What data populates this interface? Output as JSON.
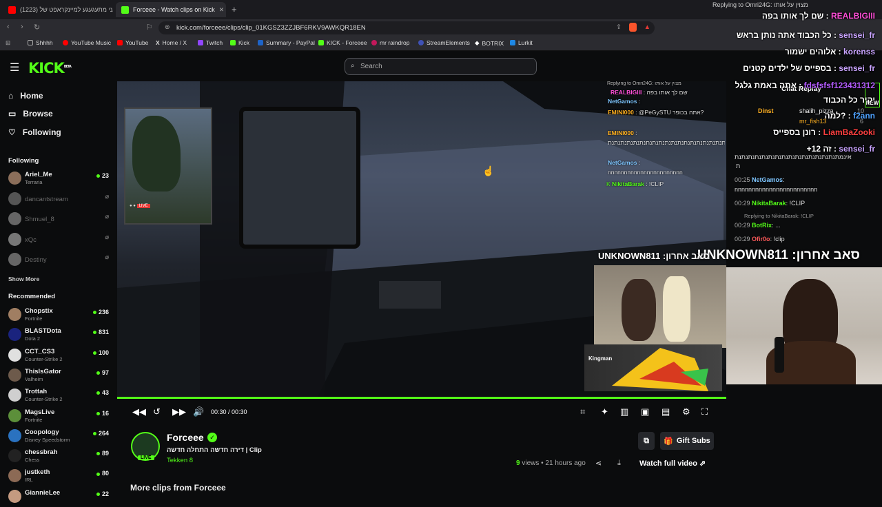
{
  "browser": {
    "tabs": [
      {
        "title": "(1223) אני מתעגעגע למיינקראפט של"
      },
      {
        "title": "Forceee - Watch clips on Kick"
      }
    ],
    "url": "kick.com/forceee/clips/clip_01KGSZ3ZZJBF6RKV9AWKQR18EN",
    "bookmarks": [
      "Shhhh",
      "YouTube Music",
      "YouTube",
      "Home / X",
      "Twitch",
      "Kick",
      "Summary - PayPal",
      "KICK - Forceee",
      "mr raindrop",
      "StreamElements",
      "BOTRIX",
      "Lurkit"
    ]
  },
  "kick": {
    "logo": "KICK",
    "logo_badge": "BETA",
    "search_placeholder": "Search"
  },
  "sidebar": {
    "nav": [
      {
        "label": "Home"
      },
      {
        "label": "Browse"
      },
      {
        "label": "Following"
      }
    ],
    "following_title": "Following",
    "following": [
      {
        "name": "Ariel_Me",
        "game": "Terraria",
        "viewers": "23",
        "live": true,
        "color": "#8b6e5a"
      },
      {
        "name": "dancantstream",
        "live": false,
        "color": "#555"
      },
      {
        "name": "Shmuel_8",
        "live": false,
        "color": "#666"
      },
      {
        "name": "xQc",
        "live": false,
        "color": "#777"
      },
      {
        "name": "Destiny",
        "live": false,
        "color": "#666"
      }
    ],
    "show_more": "Show More",
    "recommended_title": "Recommended",
    "recommended": [
      {
        "name": "Chopstix",
        "game": "Fortnite",
        "viewers": "236",
        "color": "#a07e62"
      },
      {
        "name": "BLASTDota",
        "game": "Dota 2",
        "viewers": "831",
        "color": "#1a237e"
      },
      {
        "name": "CCT_CS3",
        "game": "Counter-Strike 2",
        "viewers": "100",
        "color": "#e0e0e0"
      },
      {
        "name": "ThisIsGator",
        "game": "Valheim",
        "viewers": "97",
        "color": "#6d5a4b"
      },
      {
        "name": "Trottah",
        "game": "Counter-Strike 2",
        "viewers": "43",
        "color": "#cfcfcf"
      },
      {
        "name": "MagsLive",
        "game": "Fortnite",
        "viewers": "16",
        "color": "#5c8f3a"
      },
      {
        "name": "Coopology",
        "game": "Disney Speedstorm",
        "viewers": "264",
        "color": "#2a72c0"
      },
      {
        "name": "chessbrah",
        "game": "Chess",
        "viewers": "89",
        "color": "#222"
      },
      {
        "name": "justketh",
        "game": "IRL",
        "viewers": "80",
        "color": "#8c6a55"
      },
      {
        "name": "GiannieLee",
        "game": "",
        "viewers": "22",
        "color": "#c49a80"
      }
    ]
  },
  "player": {
    "time": "00:30 / 00:30",
    "progress": 1.0
  },
  "clip": {
    "channel": "Forceee",
    "title": "דירה חדשה התחלה חדשה | Clip",
    "game": "Tekken 8",
    "live_badge": "LIVE",
    "views_num": "9",
    "views_label": "views",
    "ago": "21 hours ago",
    "gift_subs": "Gift Subs",
    "watch_full": "Watch full video",
    "more_clips": "More clips from Forceee"
  },
  "chat_replay": {
    "title": "Chat Replay",
    "new_badge": "NEW",
    "replying_to_nikita": "Replying to NikitaBarak: !CLIP",
    "lines": [
      {
        "time": "",
        "user": "",
        "text": "אינמתנתנתנתנתנתנתנתנתנתנתנתנתנתנתנת"
      },
      {
        "time": "00:25",
        "user": "NetGamos",
        "text": "nnnnnnnnnnnnnnnnnnnnnnnn"
      },
      {
        "time": "00:29",
        "user": "NikitaBarak",
        "text": "!CLIP"
      },
      {
        "time": "00:29",
        "user": "BotRix",
        "text": "..."
      },
      {
        "time": "00:29",
        "user": "Ofir0o",
        "text": "!clip"
      }
    ],
    "side_users": [
      {
        "user": "Dinst",
        "extra": "shalih_pizza",
        "count": "10"
      },
      {
        "user": "mr_fish13",
        "count": "6"
      }
    ]
  },
  "overlay_chat": {
    "reply_header": "Replying to Omri24G: מצוין על אותו",
    "lines": [
      {
        "user": "REALBIGIII",
        "text": "שם לך אותו בפה",
        "color": "#ff4fd8"
      },
      {
        "user": "sensei_fr",
        "text": "כל הכבוד אתה נותן בראש",
        "color": "#c9a4ff"
      },
      {
        "user": "korenss",
        "text": "אלוהים ישמור",
        "color": "#c9a4ff"
      },
      {
        "user": "sensei_fr",
        "text": "בספייס של ילדים קטנים",
        "color": "#c9a4ff"
      },
      {
        "user": "fdsfsfsf123431312",
        "text": "אתה באמת גלגל",
        "color": "#b45cff"
      },
      {
        "user": "",
        "text": "יקיר כל הכבוד",
        "color": "#fff"
      },
      {
        "user": "f2ann",
        "text": "למה?",
        "color": "#4fa3ff"
      },
      {
        "user": "LiamBaZooki",
        "text": "רונן בספייס",
        "color": "#ff4040"
      },
      {
        "user": "sensei_fr",
        "text": "+12 זה",
        "color": "#c9a4ff"
      }
    ],
    "sub_banner": "UNKNOWN811 :סאב אחרון",
    "sub_banner_small": "UNKNOWN811 :סאב אחרון"
  },
  "video_chat": {
    "header": "Replying to Omri24G: מצוין על אותו",
    "lines": [
      {
        "user": "REALBIGIII",
        "text": "שם לך אותו בפה"
      },
      {
        "user": "NetGamos",
        "text": ""
      },
      {
        "user": "EMINI000",
        "text": "@PeGySTU אתה בכופר?"
      },
      {
        "user": "EMINI000",
        "text": "אינמתנתנתנתנתנתנתנתנתנתנתנתנתנתנתנתנתנתנת"
      },
      {
        "user": "NetGamos",
        "text": "nnnnnnnnnnnnnnnnnnnnnnn"
      },
      {
        "user": "NikitaBarak",
        "text": "!CLIP"
      }
    ],
    "webcam_label": "Kingman"
  },
  "colors": {
    "kick_green": "#53fc18",
    "background": "#0b0c0d"
  }
}
